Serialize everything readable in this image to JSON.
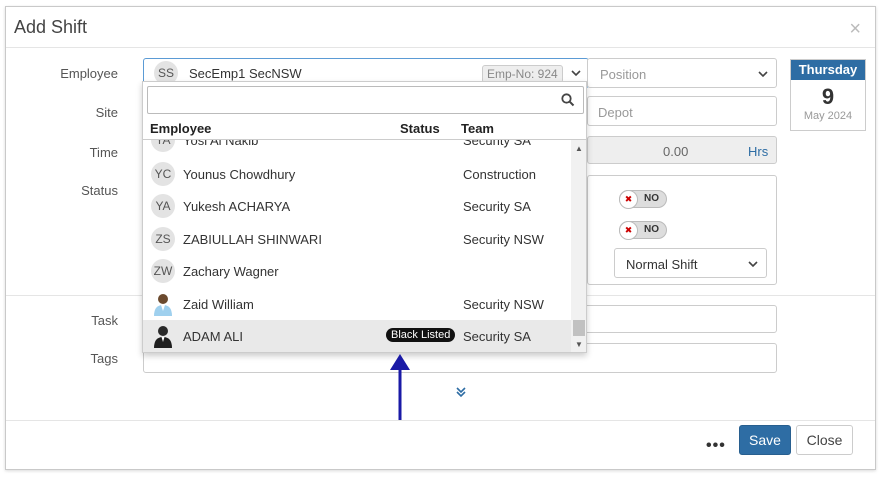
{
  "modal": {
    "title": "Add Shift",
    "close": "×"
  },
  "labels": {
    "employee": "Employee",
    "site": "Site",
    "time": "Time",
    "status": "Status",
    "task": "Task",
    "tags": "Tags"
  },
  "employee_field": {
    "initials": "SS",
    "name": "SecEmp1 SecNSW",
    "emp_no": "Emp-No: 924"
  },
  "position_field": {
    "placeholder": "Position"
  },
  "depot_field": {
    "placeholder": "Depot"
  },
  "hours_field": {
    "value": "0.00",
    "unit": "Hrs"
  },
  "date": {
    "weekday": "Thursday",
    "day": "9",
    "month_year": "May 2024"
  },
  "toggles": [
    {
      "label": "NO"
    },
    {
      "label": "NO"
    }
  ],
  "shift_type": {
    "value": "Normal Shift"
  },
  "dropdown": {
    "columns": {
      "employee": "Employee",
      "status": "Status",
      "team": "Team"
    },
    "rows": [
      {
        "initials": "YA",
        "name": "Yosi Al Nakib",
        "status": "",
        "team": "Security SA"
      },
      {
        "initials": "YC",
        "name": "Younus Chowdhury",
        "status": "",
        "team": "Construction"
      },
      {
        "initials": "YA",
        "name": "Yukesh ACHARYA",
        "status": "",
        "team": "Security SA"
      },
      {
        "initials": "ZS",
        "name": "ZABIULLAH SHINWARI",
        "status": "",
        "team": "Security NSW"
      },
      {
        "initials": "ZW",
        "name": "Zachary Wagner",
        "status": "",
        "team": ""
      },
      {
        "initials": "",
        "name": "Zaid William",
        "status": "",
        "team": "Security NSW"
      },
      {
        "initials": "",
        "name": "ADAM ALI",
        "status": "Black Listed",
        "team": "Security SA"
      }
    ]
  },
  "footer": {
    "more": "•••",
    "save": "Save",
    "close": "Close"
  },
  "colors": {
    "primary": "#2e6da4",
    "arrow": "#1a1aa6"
  }
}
